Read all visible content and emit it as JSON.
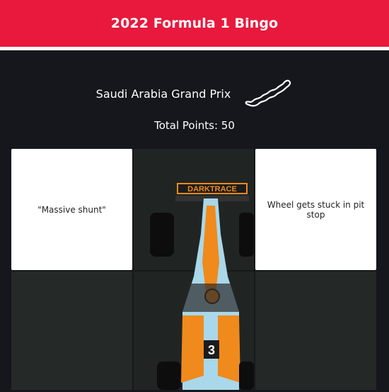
{
  "header": {
    "title": "2022 Formula 1 Bingo"
  },
  "race": {
    "name": "Saudi Arabia Grand Prix",
    "track_icon": "jeddah-circuit-outline"
  },
  "score": {
    "label": "Total Points: 50"
  },
  "grid": {
    "cells": [
      {
        "text": "\"Massive shunt\""
      },
      {
        "text": ""
      },
      {
        "text": "Wheel gets stuck in pit stop"
      },
      {
        "text": ""
      },
      {
        "text": ""
      },
      {
        "text": ""
      }
    ]
  },
  "photo": {
    "car_sponsor": "DARKTRACE",
    "car_number": "3"
  },
  "colors": {
    "accent": "#e8193c",
    "background": "#16161d",
    "card": "#ffffff",
    "livery_blue": "#a9d8ea",
    "livery_orange": "#f08a1c"
  }
}
